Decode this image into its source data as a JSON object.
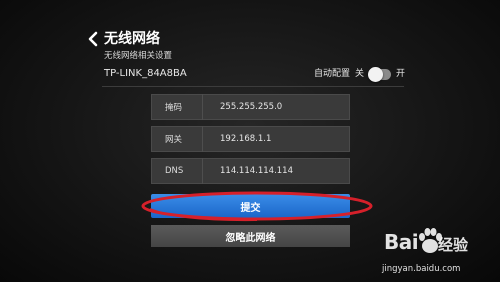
{
  "header": {
    "title": "无线网络",
    "subtitle": "无线网络相关设置"
  },
  "network": {
    "ssid": "TP-LINK_84A8BA",
    "auto_config_label": "自动配置",
    "toggle_off_label": "关",
    "toggle_on_label": "开",
    "toggle_state": "off"
  },
  "fields": [
    {
      "label": "掩码",
      "value": "255.255.255.0"
    },
    {
      "label": "网关",
      "value": "192.168.1.1"
    },
    {
      "label": "DNS",
      "value": "114.114.114.114"
    }
  ],
  "buttons": {
    "submit_label": "提交",
    "forget_label": "忽略此网络"
  },
  "watermark": {
    "brand_left": "Bai",
    "brand_right": "经验",
    "url": "jingyan.baidu.com"
  },
  "colors": {
    "accent_blue": "#2a7ad9",
    "highlight_red": "#d6202a"
  },
  "icons": {
    "back": "chevron-left-icon",
    "logo": "baidu-paw-icon"
  }
}
